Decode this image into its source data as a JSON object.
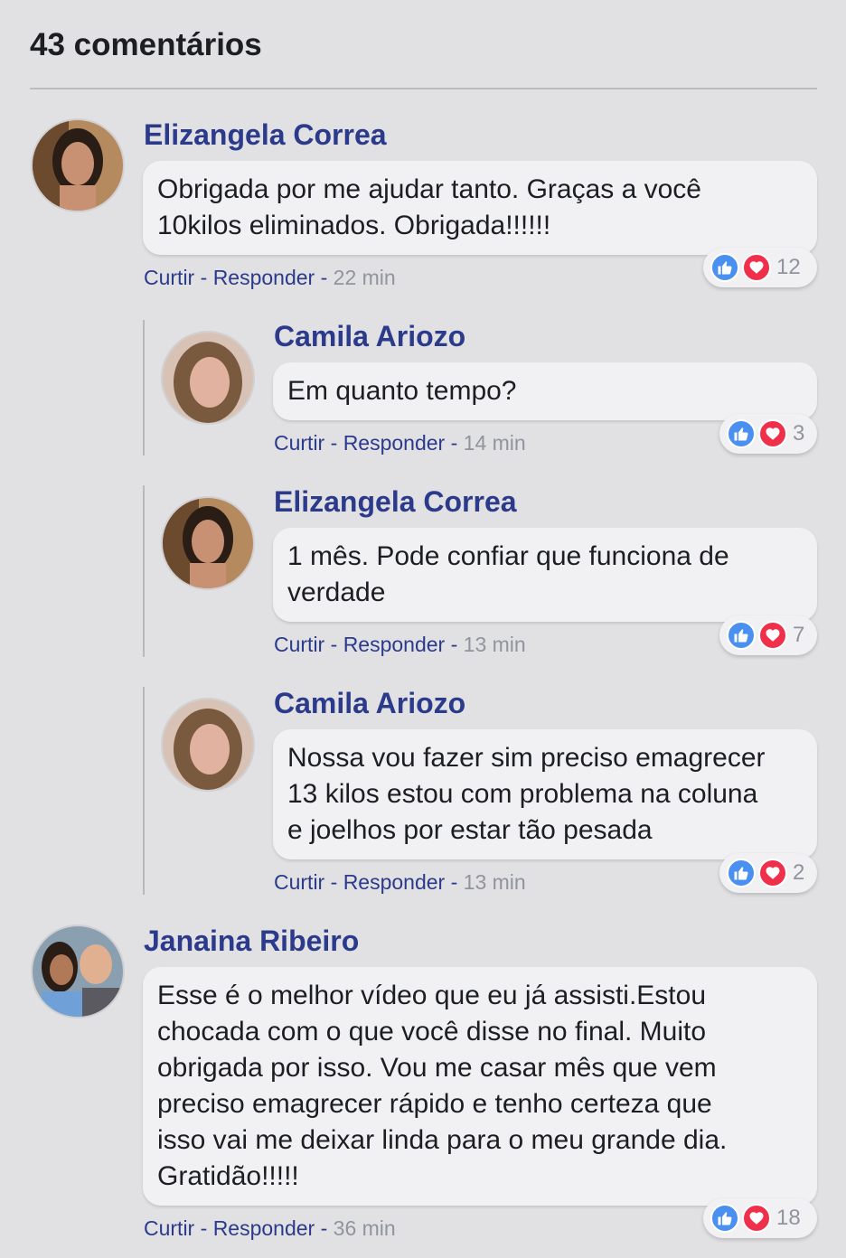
{
  "header": {
    "title": "43 comentários"
  },
  "labels": {
    "like": "Curtir",
    "separator": " - ",
    "reply": "Responder"
  },
  "colors": {
    "author": "#2b3a8a",
    "time": "#90949c",
    "like": "#4a90f0",
    "heart": "#f0304a"
  },
  "comments": [
    {
      "author": "Elizangela Correa",
      "text": "Obrigada por me ajudar tanto. Graças a você\n10kilos eliminados. Obrigada!!!!!!",
      "time": "22 min",
      "reactions": "12"
    },
    {
      "author": "Camila Ariozo",
      "text": "Em quanto tempo?",
      "time": "14 min",
      "reactions": "3"
    },
    {
      "author": "Elizangela Correa",
      "text": "1 mês. Pode confiar que funciona de\nverdade",
      "time": "13 min",
      "reactions": "7"
    },
    {
      "author": "Camila Ariozo",
      "text": "Nossa vou fazer sim preciso emagrecer\n13 kilos estou com problema na coluna\ne joelhos por estar tão pesada",
      "time": "13 min",
      "reactions": "2"
    },
    {
      "author": "Janaina Ribeiro",
      "text": "Esse é o melhor vídeo que eu já assisti.Estou\nchocada com o que você disse no final. Muito\nobrigada por isso. Vou me casar mês que vem\npreciso emagrecer rápido e tenho certeza que\nisso vai me deixar linda para o meu grande dia.\nGratidão!!!!!",
      "time": "36 min",
      "reactions": "18"
    }
  ]
}
